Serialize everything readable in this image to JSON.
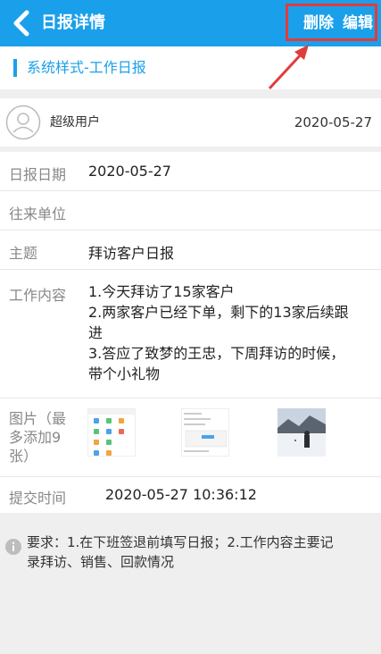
{
  "header": {
    "title": "日报详情",
    "delete_label": "删除",
    "edit_label": "编辑"
  },
  "subheader": {
    "title": "系统样式-工作日报"
  },
  "user": {
    "name": "超级用户",
    "date": "2020-05-27"
  },
  "details": {
    "report_date_label": "日报日期",
    "report_date_value": "2020-05-27",
    "unit_label": "往来单位",
    "unit_value": "",
    "subject_label": "主题",
    "subject_value": "拜访客户日报",
    "content_label": "工作内容",
    "content_lines": [
      "1.今天拜访了15家客户",
      "2.两家客户已经下单，剩下的13家后续跟",
      "进",
      "3.答应了致梦的王忠，下周拜访的时候，",
      "带个小礼物"
    ],
    "images_label_lines": [
      "图片（最",
      "多添加9",
      "张）"
    ],
    "submit_time_label": "提交时间",
    "submit_time_value": "2020-05-27 10:36:12"
  },
  "note": {
    "lines": [
      "要求：1.在下班签退前填写日报；2.工作内容主要记",
      "录拜访、销售、回款情况"
    ]
  },
  "colors": {
    "accent": "#1aa0ea",
    "highlight": "#e23b3b"
  }
}
